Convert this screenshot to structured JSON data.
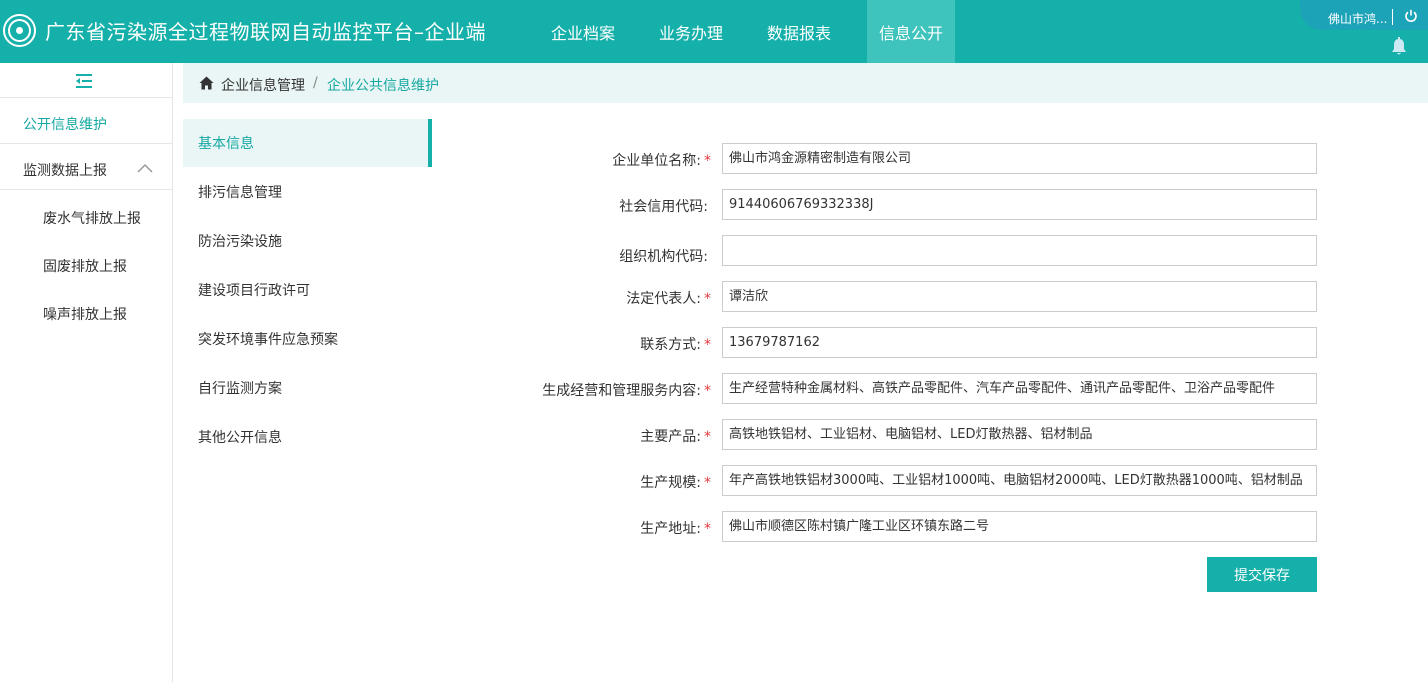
{
  "header": {
    "title": "广东省污染源全过程物联网自动监控平台–企业端",
    "nav": [
      "企业档案",
      "业务办理",
      "数据报表",
      "信息公开"
    ],
    "user_name": "佛山市鸿...",
    "colors": {
      "primary": "#16b0aa",
      "active_nav": "#3ec3bd",
      "required": "#e4393c"
    }
  },
  "sidebar": {
    "items": [
      {
        "label": "公开信息维护"
      },
      {
        "label": "监测数据上报"
      }
    ],
    "sub_items": [
      "废水气排放上报",
      "固废排放上报",
      "噪声排放上报"
    ]
  },
  "breadcrumb": {
    "level1": "企业信息管理",
    "separator": "/",
    "level2": "企业公共信息维护"
  },
  "submenu": [
    "基本信息",
    "排污信息管理",
    "防治污染设施",
    "建设项目行政许可",
    "突发环境事件应急预案",
    "自行监测方案",
    "其他公开信息"
  ],
  "form": {
    "fields": [
      {
        "label": "企业单位名称:",
        "required": "*",
        "value": "佛山市鸿金源精密制造有限公司"
      },
      {
        "label": "社会信用代码:",
        "required": "",
        "value": "91440606769332338J"
      },
      {
        "label": "组织机构代码:",
        "required": "",
        "value": ""
      },
      {
        "label": "法定代表人:",
        "required": "*",
        "value": "谭洁欣"
      },
      {
        "label": "联系方式:",
        "required": "*",
        "value": "13679787162"
      },
      {
        "label": "生成经营和管理服务内容:",
        "required": "*",
        "value": "生产经营特种金属材料、高铁产品零配件、汽车产品零配件、通讯产品零配件、卫浴产品零配件"
      },
      {
        "label": "主要产品:",
        "required": "*",
        "value": "高铁地铁铝材、工业铝材、电脑铝材、LED灯散热器、铝材制品"
      },
      {
        "label": "生产规模:",
        "required": "*",
        "value": "年产高铁地铁铝材3000吨、工业铝材1000吨、电脑铝材2000吨、LED灯散热器1000吨、铝材制品"
      },
      {
        "label": "生产地址:",
        "required": "*",
        "value": "佛山市顺德区陈村镇广隆工业区环镇东路二号"
      }
    ],
    "submit_label": "提交保存"
  }
}
